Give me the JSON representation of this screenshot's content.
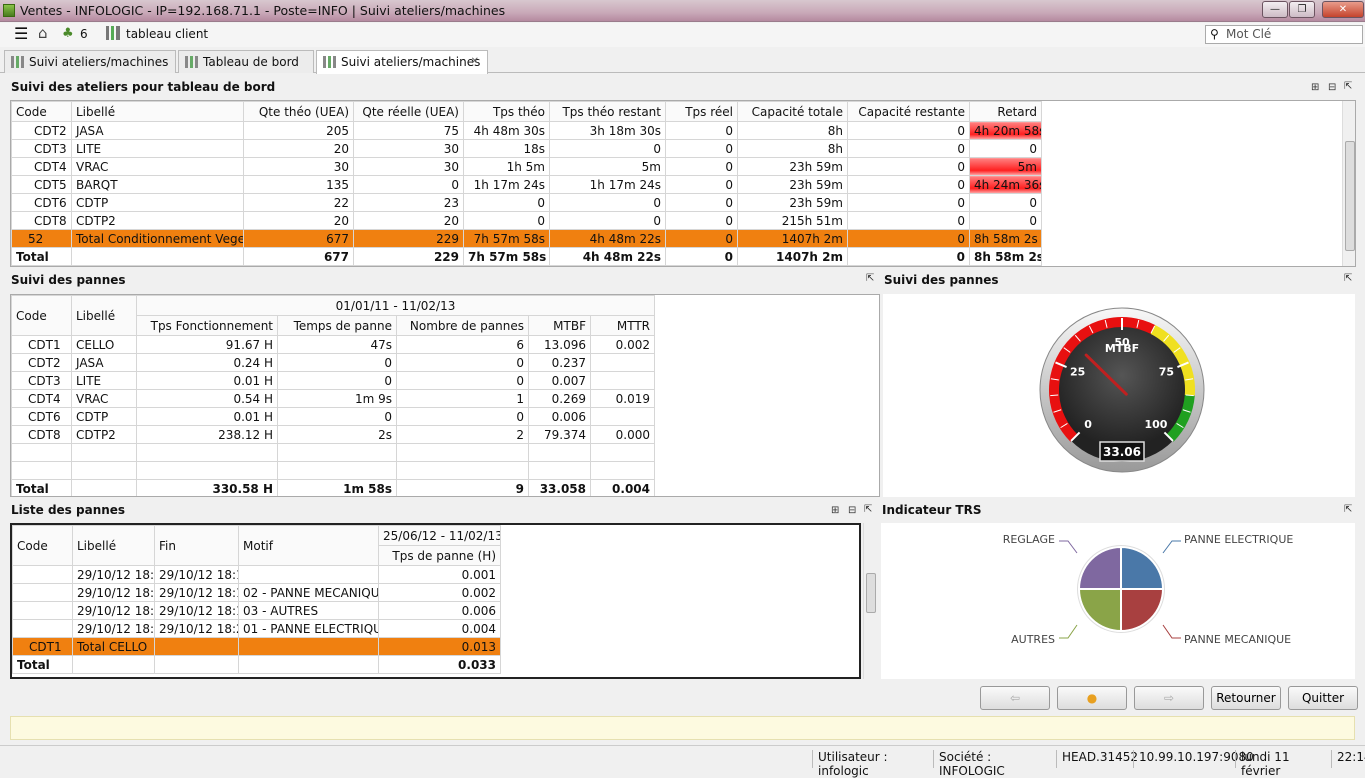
{
  "window": {
    "title": "Ventes - INFOLOGIC - IP=192.168.71.1 - Poste=INFO | Suivi ateliers/machines",
    "min": "—",
    "max": "❐",
    "close": "✕"
  },
  "toolbar": {
    "count": "6",
    "label": "tableau client",
    "search_placeholder": "Mot Clé"
  },
  "tabs": [
    {
      "label": "Suivi ateliers/machines"
    },
    {
      "label": "Tableau de bord"
    },
    {
      "label": "Suivi ateliers/machines",
      "close": "✕"
    }
  ],
  "ateliers": {
    "title": "Suivi des ateliers pour tableau de bord",
    "headers": [
      "Code",
      "Libellé",
      "Qte théo (UEA)",
      "Qte réelle (UEA)",
      "Tps théo",
      "Tps théo restant",
      "Tps réel",
      "Capacité totale",
      "Capacité restante",
      "Retard"
    ],
    "rows": [
      [
        "CDT2",
        "JASA",
        "205",
        "75",
        "4h 48m 30s",
        "3h 18m 30s",
        "0",
        "8h",
        "0",
        "4h 20m 58s"
      ],
      [
        "CDT3",
        "LITE",
        "20",
        "30",
        "18s",
        "0",
        "0",
        "8h",
        "0",
        "0"
      ],
      [
        "CDT4",
        "VRAC",
        "30",
        "30",
        "1h 5m",
        "5m",
        "0",
        "23h 59m",
        "0",
        "5m"
      ],
      [
        "CDT5",
        "BARQT",
        "135",
        "0",
        "1h 17m 24s",
        "1h 17m 24s",
        "0",
        "23h 59m",
        "0",
        "4h 24m 36s"
      ],
      [
        "CDT6",
        "CDTP",
        "22",
        "23",
        "0",
        "0",
        "0",
        "23h 59m",
        "0",
        "0"
      ],
      [
        "CDT8",
        "CDTP2",
        "20",
        "20",
        "0",
        "0",
        "0",
        "215h 51m",
        "0",
        "0"
      ]
    ],
    "subtotal": [
      "52",
      "Total Conditionnement Vegetal",
      "677",
      "229",
      "7h 57m 58s",
      "4h 48m 22s",
      "0",
      "1407h 2m",
      "0",
      "8h 58m 2s"
    ],
    "total": [
      "Total",
      "",
      "677",
      "229",
      "7h 57m 58s",
      "4h 48m 22s",
      "0",
      "1407h 2m",
      "0",
      "8h 58m 2s"
    ]
  },
  "pannes": {
    "title": "Suivi des pannes",
    "period": "01/01/11 - 11/02/13",
    "headers": [
      "Code",
      "Libellé",
      "Tps Fonctionnement",
      "Temps de panne",
      "Nombre de pannes",
      "MTBF",
      "MTTR"
    ],
    "rows": [
      [
        "CDT1",
        "CELLO",
        "91.67 H",
        "47s",
        "6",
        "13.096",
        "0.002"
      ],
      [
        "CDT2",
        "JASA",
        "0.24 H",
        "0",
        "0",
        "0.237",
        ""
      ],
      [
        "CDT3",
        "LITE",
        "0.01 H",
        "0",
        "0",
        "0.007",
        ""
      ],
      [
        "CDT4",
        "VRAC",
        "0.54 H",
        "1m 9s",
        "1",
        "0.269",
        "0.019"
      ],
      [
        "CDT6",
        "CDTP",
        "0.01 H",
        "0",
        "0",
        "0.006",
        ""
      ],
      [
        "CDT8",
        "CDTP2",
        "238.12 H",
        "2s",
        "2",
        "79.374",
        "0.000"
      ]
    ],
    "total": [
      "Total",
      "",
      "330.58 H",
      "1m 58s",
      "9",
      "33.058",
      "0.004"
    ]
  },
  "gauge": {
    "title": "Suivi des pannes",
    "label": "MTBF",
    "value": "33.06",
    "value_num": 33.06,
    "ticks": [
      "0",
      "25",
      "50",
      "75",
      "100"
    ]
  },
  "liste": {
    "title": "Liste des pannes",
    "period": "25/06/12 - 11/02/13",
    "headers": [
      "Code",
      "Libellé",
      "Fin",
      "Motif",
      "Tps de panne (H)"
    ],
    "rows": [
      [
        "",
        "29/10/12 18:10",
        "29/10/12 18:10",
        "",
        "0.001"
      ],
      [
        "",
        "29/10/12 18:11",
        "29/10/12 18:11",
        "02 - PANNE MECANIQUE",
        "0.002"
      ],
      [
        "",
        "29/10/12 18:12",
        "29/10/12 18:12",
        "03 - AUTRES",
        "0.006"
      ],
      [
        "",
        "29/10/12 18:23",
        "29/10/12 18:23",
        "01 - PANNE ELECTRIQUE",
        "0.004"
      ]
    ],
    "subtotal": [
      "CDT1",
      "Total CELLO",
      "",
      "",
      "0.013"
    ],
    "total": [
      "Total",
      "",
      "",
      "",
      "0.033"
    ]
  },
  "trs": {
    "title": "Indicateur TRS",
    "slices": [
      {
        "label": "REGLAGE",
        "color": "#7f68a0",
        "value": 25
      },
      {
        "label": "PANNE ELECTRIQUE",
        "color": "#4a78a8",
        "value": 25
      },
      {
        "label": "PANNE MECANIQUE",
        "color": "#a84040",
        "value": 25
      },
      {
        "label": "AUTRES",
        "color": "#8aa448",
        "value": 25
      }
    ]
  },
  "buttons": {
    "back": "⇦",
    "home": "●",
    "forward": "⇨",
    "retourner": "Retourner",
    "quitter": "Quitter"
  },
  "status": {
    "user": "Utilisateur : infologic",
    "company": "Société : INFOLOGIC",
    "head": "HEAD.31452",
    "ip": "10.99.10.197:9080",
    "date": "lundi 11 février",
    "time": "22:14"
  }
}
